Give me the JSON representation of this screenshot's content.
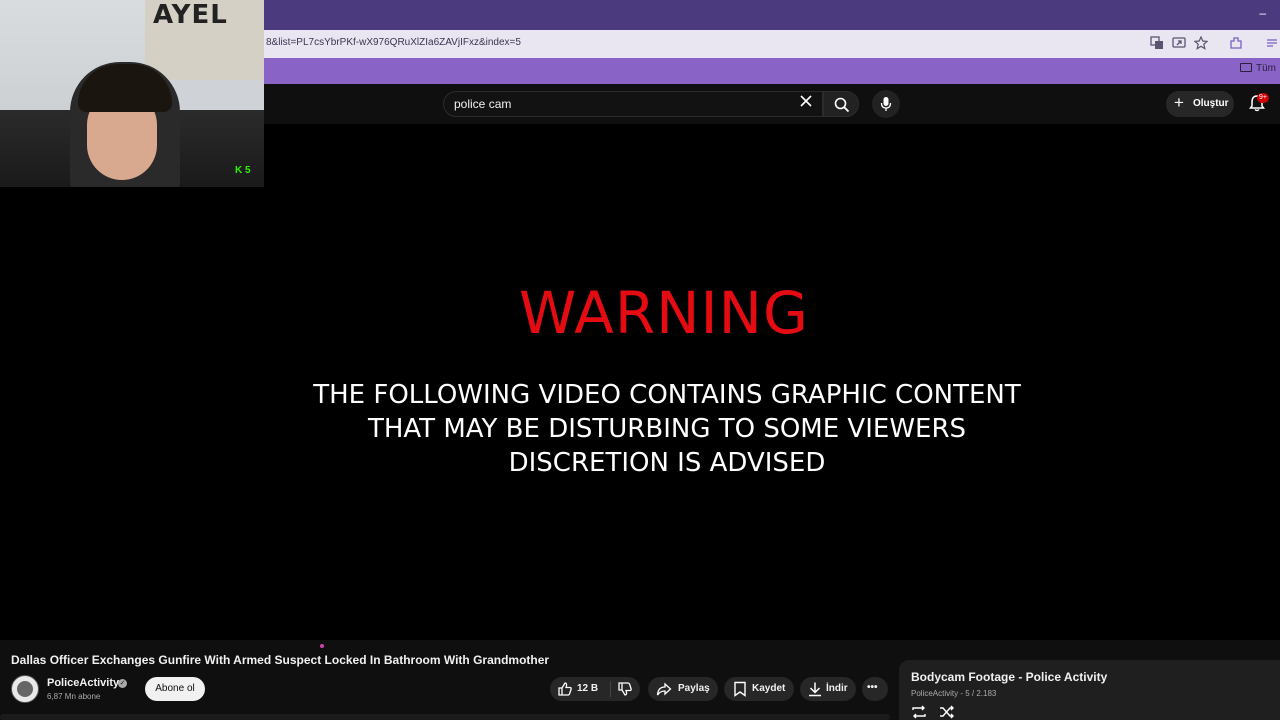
{
  "browser": {
    "url": "8&list=PL7csYbrPKf-wX976QRuXlZIa6ZAVjIFxz&index=5",
    "window_minimize": "–",
    "bookmark_folder": "Tüm"
  },
  "header": {
    "search_query": "police cam",
    "create_label": "Oluştur",
    "notifications_badge": "9+"
  },
  "webcam": {
    "poster_text": "AYEL",
    "overlay_badge": "K 5"
  },
  "video": {
    "warning_title": "WARNING",
    "warning_lines": [
      "THE FOLLOWING VIDEO CONTAINS GRAPHIC CONTENT",
      "THAT MAY BE DISTURBING TO SOME VIEWERS",
      "DISCRETION IS ADVISED"
    ],
    "title": "Dallas Officer Exchanges Gunfire With Armed Suspect Locked In Bathroom With Grandmother"
  },
  "channel": {
    "name": "PoliceActivity",
    "subscribers": "6,87 Mn abone",
    "subscribe_label": "Abone ol"
  },
  "actions": {
    "likes": "12 B",
    "share_label": "Paylaş",
    "save_label": "Kaydet",
    "download_label": "İndir",
    "more_label": "•••"
  },
  "playlist": {
    "title": "Bodycam Footage - Police Activity",
    "subtitle": "PoliceActivity - 5 / 2.183"
  },
  "colors": {
    "warning_red": "#e40b12",
    "browser_frame": "#4b3a7e",
    "bookmark_bar": "#8a63c7",
    "overlay_green": "#2ef000"
  }
}
